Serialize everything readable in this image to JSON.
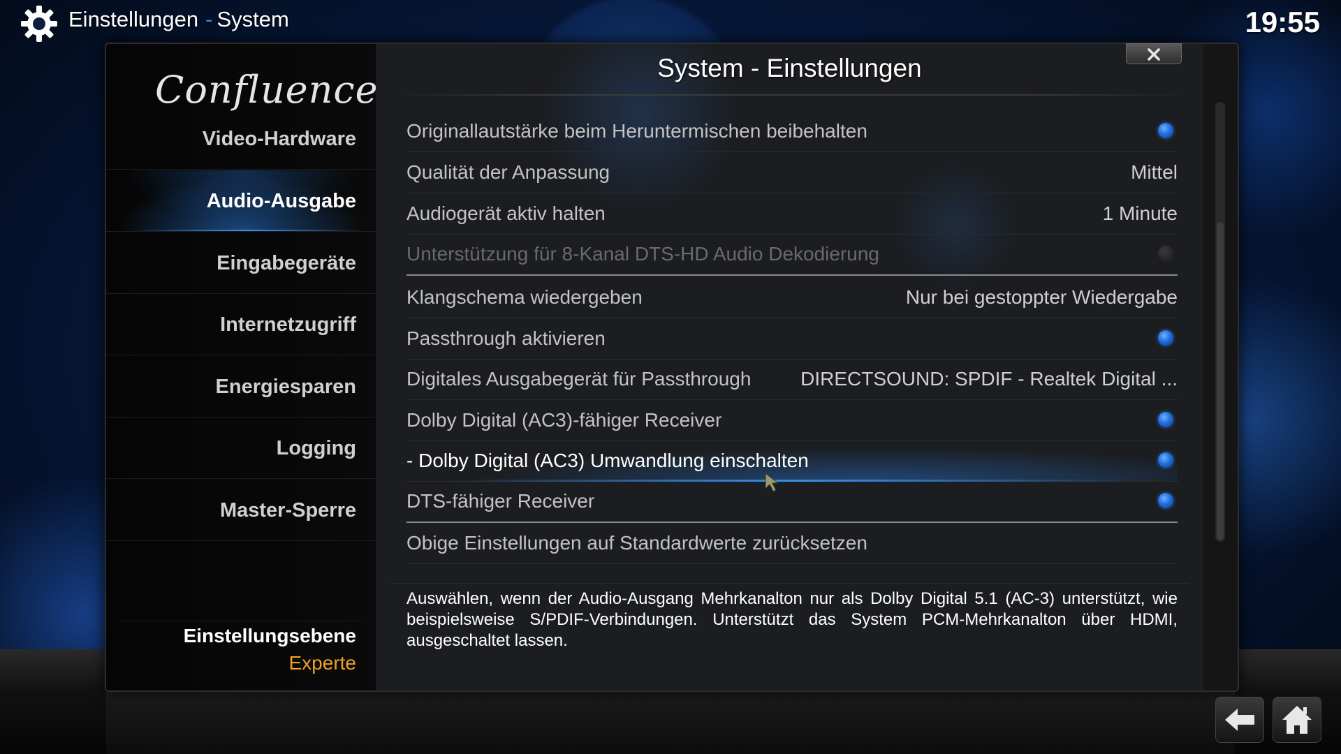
{
  "header": {
    "section": "Einstellungen",
    "subsection": "System",
    "separator": "-",
    "clock": "19:55"
  },
  "sidebar": {
    "logo_text": "Confluence",
    "items": [
      {
        "label": "Video-Hardware",
        "active": false
      },
      {
        "label": "Audio-Ausgabe",
        "active": true
      },
      {
        "label": "Eingabegeräte",
        "active": false
      },
      {
        "label": "Internetzugriff",
        "active": false
      },
      {
        "label": "Energiesparen",
        "active": false
      },
      {
        "label": "Logging",
        "active": false
      },
      {
        "label": "Master-Sperre",
        "active": false
      }
    ],
    "level_label": "Einstellungsebene",
    "level_value": "Experte"
  },
  "content": {
    "title": "System - Einstellungen",
    "settings": [
      {
        "label": "Originallautstärke beim Heruntermischen beibehalten",
        "type": "toggle",
        "enabled": true,
        "disabled": false
      },
      {
        "label": "Qualität der Anpassung",
        "type": "value",
        "value": "Mittel"
      },
      {
        "label": "Audiogerät aktiv halten",
        "type": "value",
        "value": "1 Minute"
      },
      {
        "label": "Unterstützung für 8-Kanal DTS-HD Audio Dekodierung",
        "type": "toggle",
        "enabled": false,
        "disabled": true
      },
      {
        "label": "Klangschema wiedergeben",
        "type": "value",
        "value": "Nur bei gestoppter Wiedergabe"
      },
      {
        "label": "Passthrough aktivieren",
        "type": "toggle",
        "enabled": true
      },
      {
        "label": "Digitales Ausgabegerät für Passthrough",
        "type": "value",
        "value": "DIRECTSOUND: SPDIF - Realtek Digital ..."
      },
      {
        "label": "Dolby Digital (AC3)-fähiger Receiver",
        "type": "toggle",
        "enabled": true
      },
      {
        "label": "- Dolby Digital (AC3) Umwandlung einschalten",
        "type": "toggle",
        "enabled": true,
        "focused": true
      },
      {
        "label": "DTS-fähiger Receiver",
        "type": "toggle",
        "enabled": true
      },
      {
        "label": "Obige Einstellungen auf Standardwerte zurücksetzen",
        "type": "action"
      }
    ],
    "description": "Auswählen, wenn der Audio-Ausgang Mehrkanalton nur als Dolby Digital 5.1 (AC-3) unterstützt, wie beispielsweise S/PDIF-Verbindungen. Unterstützt das System PCM-Mehrkanalton über HDMI, ausgeschaltet lassen."
  },
  "icons": {
    "gear": "gear-icon",
    "close": "close-icon",
    "back": "back-arrow-icon",
    "home": "home-icon"
  },
  "colors": {
    "accent": "#3a8fe8",
    "level_value": "#f0a020",
    "background": "#0b2f6a"
  }
}
